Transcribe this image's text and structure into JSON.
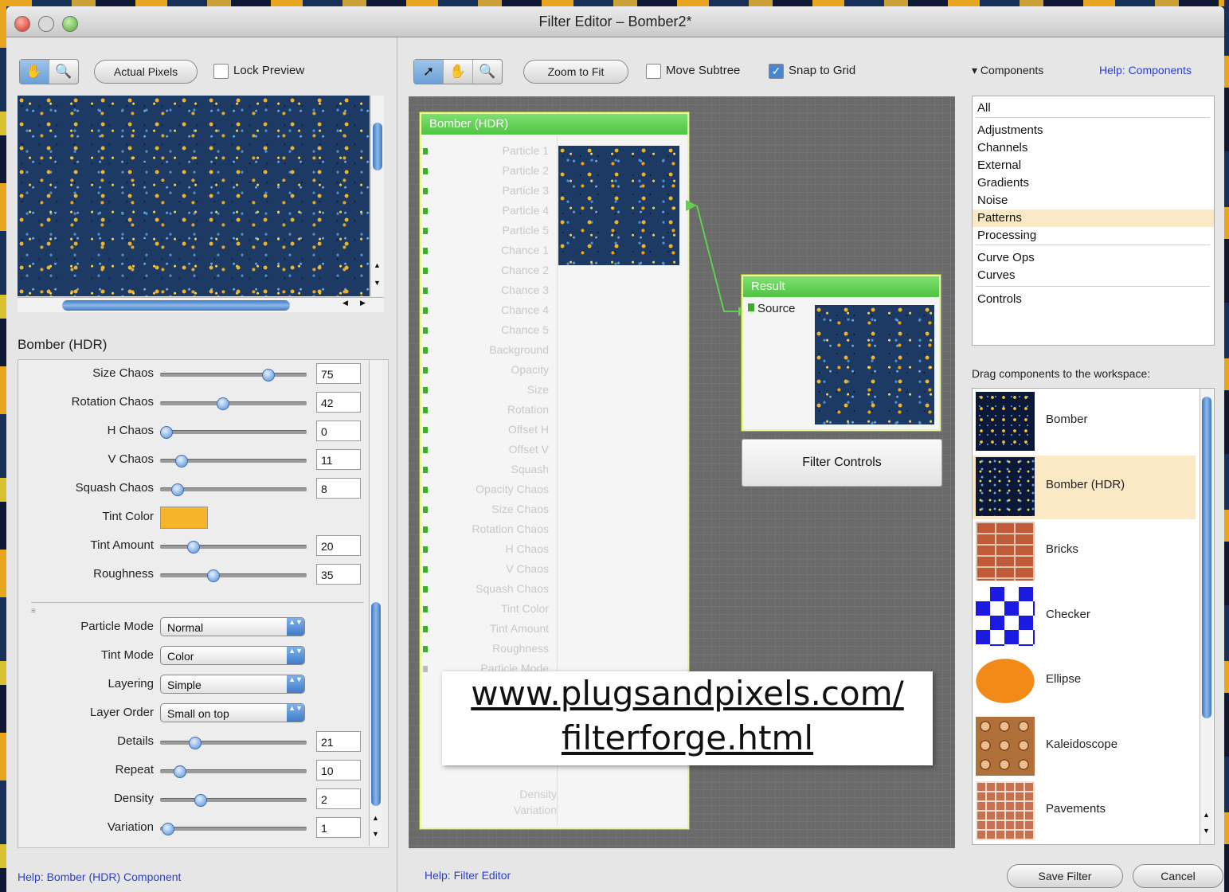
{
  "window": {
    "title": "Filter Editor – Bomber2*"
  },
  "preview_panel": {
    "actual_pixels_label": "Actual Pixels",
    "lock_preview_label": "Lock Preview",
    "component_title": "Bomber (HDR)",
    "params": [
      {
        "label": "Size Chaos",
        "value": "75",
        "fraction": 0.75
      },
      {
        "label": "Rotation Chaos",
        "value": "42",
        "fraction": 0.42
      },
      {
        "label": "H Chaos",
        "value": "0",
        "fraction": 0.0
      },
      {
        "label": "V Chaos",
        "value": "11",
        "fraction": 0.11
      },
      {
        "label": "Squash Chaos",
        "value": "8",
        "fraction": 0.08
      },
      {
        "label": "Tint Color",
        "color": "#f5b429"
      },
      {
        "label": "Tint Amount",
        "value": "20",
        "fraction": 0.2
      },
      {
        "label": "Roughness",
        "value": "35",
        "fraction": 0.35
      }
    ],
    "modes": [
      {
        "label": "Particle Mode",
        "value": "Normal"
      },
      {
        "label": "Tint Mode",
        "value": "Color"
      },
      {
        "label": "Layering",
        "value": "Simple"
      },
      {
        "label": "Layer Order",
        "value": "Small on top"
      }
    ],
    "params2": [
      {
        "label": "Details",
        "value": "21",
        "fraction": 0.21
      },
      {
        "label": "Repeat",
        "value": "10",
        "fraction": 0.1
      },
      {
        "label": "Density",
        "value": "2",
        "fraction": 0.25
      },
      {
        "label": "Variation",
        "value": "1",
        "fraction": 0.01
      }
    ],
    "help_link": "Help: Bomber (HDR) Component"
  },
  "workspace": {
    "zoom_to_fit_label": "Zoom to Fit",
    "move_subtree_label": "Move Subtree",
    "snap_to_grid_label": "Snap to Grid",
    "snap_to_grid_checked": true,
    "bomber_node": {
      "title": "Bomber (HDR)",
      "ports": [
        "Particle 1",
        "Particle 2",
        "Particle 3",
        "Particle 4",
        "Particle 5",
        "Chance 1",
        "Chance 2",
        "Chance 3",
        "Chance 4",
        "Chance 5",
        "Background",
        "Opacity",
        "Size",
        "Rotation",
        "Offset H",
        "Offset V",
        "Squash",
        "Opacity Chaos",
        "Size Chaos",
        "Rotation Chaos",
        "H Chaos",
        "V Chaos",
        "Squash Chaos",
        "Tint Color",
        "Tint Amount",
        "Roughness",
        "Particle Mode"
      ],
      "bottom_ports": [
        "Density",
        "Variation"
      ]
    },
    "result_node": {
      "title": "Result",
      "port": "Source"
    },
    "filter_controls_label": "Filter Controls",
    "help_link": "Help: Filter Editor",
    "watermark_line1": "www.plugsandpixels.com/",
    "watermark_line2": "filterforge.html"
  },
  "components_panel": {
    "header": "▾ Components",
    "help_link": "Help: Components",
    "categories": [
      {
        "label": "All",
        "selected": false
      },
      {
        "label": "Adjustments",
        "selected": false
      },
      {
        "label": "Channels",
        "selected": false
      },
      {
        "label": "External",
        "selected": false
      },
      {
        "label": "Gradients",
        "selected": false
      },
      {
        "label": "Noise",
        "selected": false
      },
      {
        "label": "Patterns",
        "selected": true
      },
      {
        "label": "Processing",
        "selected": false
      },
      {
        "label": "Curve Ops",
        "selected": false
      },
      {
        "label": "Curves",
        "selected": false
      },
      {
        "label": "Controls",
        "selected": false
      }
    ],
    "drag_hint": "Drag components to the workspace:",
    "items": [
      {
        "label": "Bomber",
        "icon": "bomber-thumb",
        "selected": false
      },
      {
        "label": "Bomber (HDR)",
        "icon": "bomber-hdr-thumb",
        "selected": true
      },
      {
        "label": "Bricks",
        "icon": "bricks-thumb",
        "selected": false
      },
      {
        "label": "Checker",
        "icon": "checker-thumb",
        "selected": false
      },
      {
        "label": "Ellipse",
        "icon": "ellipse-thumb",
        "selected": false
      },
      {
        "label": "Kaleidoscope",
        "icon": "kaleidoscope-thumb",
        "selected": false
      },
      {
        "label": "Pavements",
        "icon": "pavements-thumb",
        "selected": false
      }
    ],
    "save_filter_label": "Save Filter",
    "cancel_label": "Cancel"
  },
  "colors": {
    "accent": "#4a86cf",
    "node_header": "#4fc442",
    "tint": "#f5b429",
    "selection": "#fbe9c6"
  }
}
